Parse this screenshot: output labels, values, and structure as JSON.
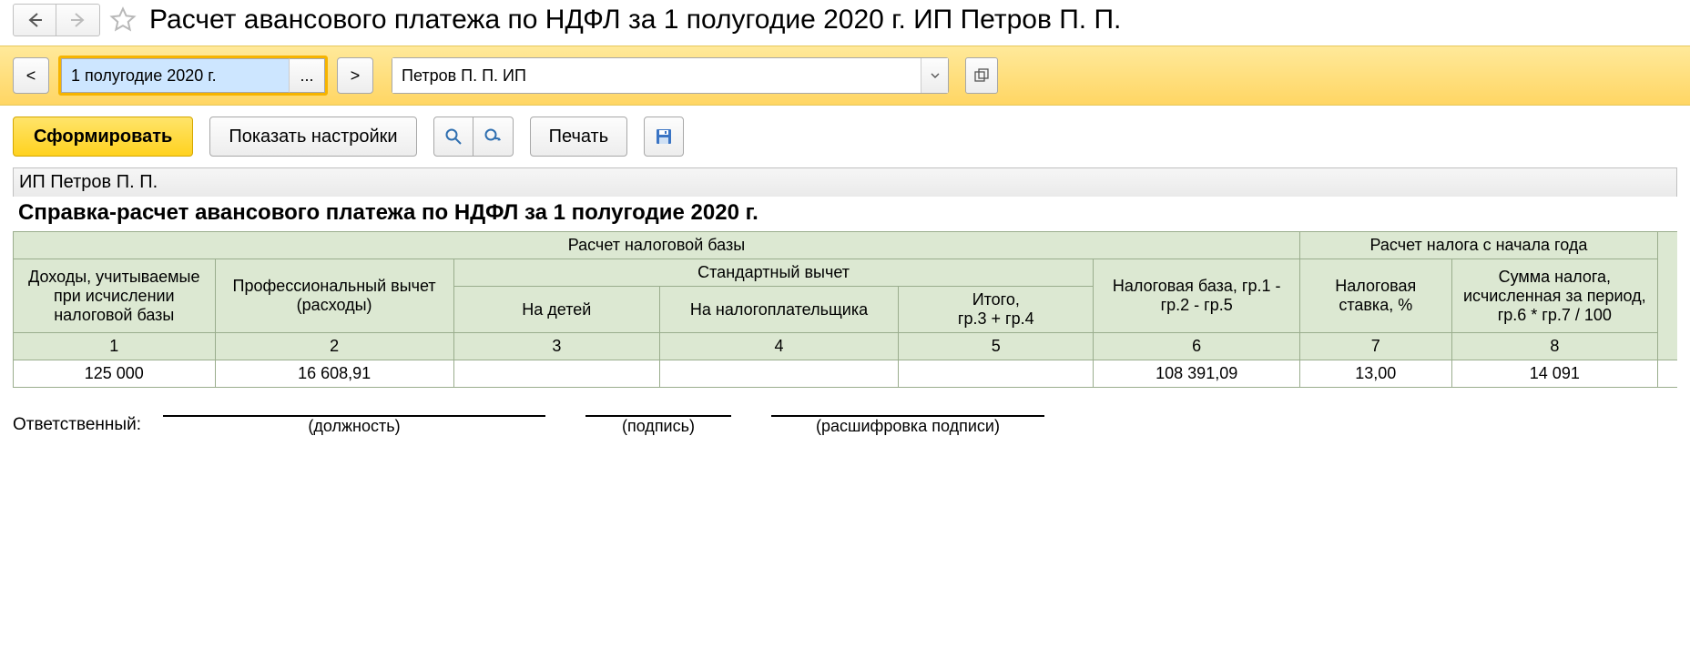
{
  "header": {
    "title": "Расчет авансового платежа по НДФЛ за 1 полугодие 2020 г. ИП Петров П. П."
  },
  "filter": {
    "period_value": "1 полугодие 2020 г.",
    "entity_value": "Петров П. П. ИП"
  },
  "toolbar": {
    "form_label": "Сформировать",
    "settings_label": "Показать настройки",
    "print_label": "Печать"
  },
  "report": {
    "org": "ИП Петров П. П.",
    "title": "Справка-расчет авансового платежа по НДФЛ за 1 полугодие 2020 г.",
    "group_headers": {
      "base": "Расчет налоговой базы",
      "tax": "Расчет налога с начала года",
      "std_ded": "Стандартный вычет"
    },
    "columns": {
      "c1": "Доходы, учитываемые при исчислении налоговой базы",
      "c2": "Профессиональный вычет (расходы)",
      "c3": "На детей",
      "c4": "На налогоплательщика",
      "c5": "Итого,\nгр.3 + гр.4",
      "c6": "Налоговая база, гр.1 - гр.2 - гр.5",
      "c7": "Налоговая ставка, %",
      "c8": "Сумма налога, исчисленная за период,\nгр.6 * гр.7 / 100"
    },
    "colnums": {
      "c1": "1",
      "c2": "2",
      "c3": "3",
      "c4": "4",
      "c5": "5",
      "c6": "6",
      "c7": "7",
      "c8": "8"
    },
    "row": {
      "c1": "125 000",
      "c2": "16 608,91",
      "c3": "",
      "c4": "",
      "c5": "",
      "c6": "108 391,09",
      "c7": "13,00",
      "c8": "14 091"
    },
    "sign": {
      "label": "Ответственный:",
      "position": "(должность)",
      "signature": "(подпись)",
      "fullname": "(расшифровка подписи)"
    }
  }
}
